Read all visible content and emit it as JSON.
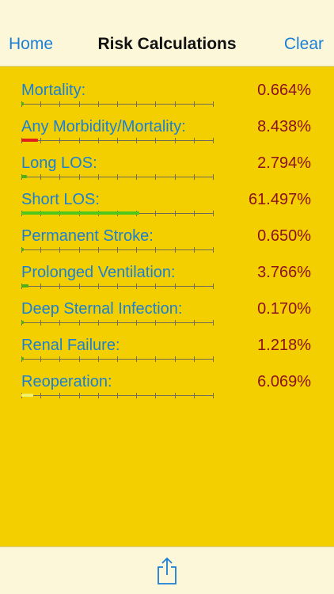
{
  "nav": {
    "left_label": "Home",
    "title": "Risk Calculations",
    "right_label": "Clear"
  },
  "colors": {
    "label": "#1a7fd6",
    "value": "#8b0f1f",
    "background": "#f3cf00",
    "bar_bars": "#5cc81a"
  },
  "risks": [
    {
      "label": "Mortality:",
      "value": "0.664%",
      "level": 0.00664,
      "bar_color": "#4caf1a"
    },
    {
      "label": "Any Morbidity/Mortality:",
      "value": "8.438%",
      "level": 0.08438,
      "bar_color": "#e0201a"
    },
    {
      "label": "Long LOS:",
      "value": "2.794%",
      "level": 0.02794,
      "bar_color": "#4caf1a"
    },
    {
      "label": "Short LOS:",
      "value": "61.497%",
      "level": 0.61497,
      "bar_color": "#4fc61a"
    },
    {
      "label": "Permanent Stroke:",
      "value": "0.650%",
      "level": 0.0065,
      "bar_color": "#4caf1a"
    },
    {
      "label": "Prolonged Ventilation:",
      "value": "3.766%",
      "level": 0.03766,
      "bar_color": "#4caf1a"
    },
    {
      "label": "Deep Sternal Infection:",
      "value": "0.170%",
      "level": 0.0017,
      "bar_color": "#4caf1a"
    },
    {
      "label": "Renal Failure:",
      "value": "1.218%",
      "level": 0.01218,
      "bar_color": "#4caf1a"
    },
    {
      "label": "Reoperation:",
      "value": "6.069%",
      "level": 0.06069,
      "bar_color": "#f2f06a"
    }
  ],
  "toolbar": {
    "share_icon": "share-icon"
  }
}
